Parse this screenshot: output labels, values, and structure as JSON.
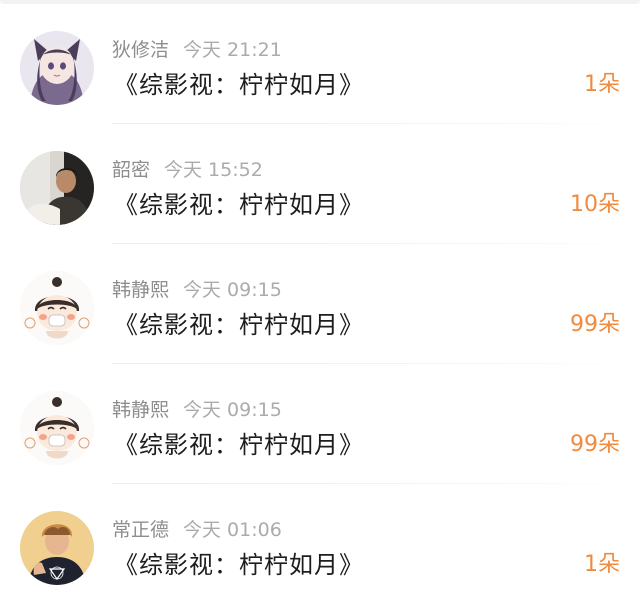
{
  "gifts": [
    {
      "user": "狄修洁",
      "time": "今天 21:21",
      "title": "《综影视：柠柠如月》",
      "count": "1朵",
      "avatar_icon": "anime-cat-girl-avatar"
    },
    {
      "user": "韶密",
      "time": "今天 15:52",
      "title": "《综影视：柠柠如月》",
      "count": "10朵",
      "avatar_icon": "person-photo-avatar"
    },
    {
      "user": "韩静熙",
      "time": "今天 09:15",
      "title": "《综影视：柠柠如月》",
      "count": "99朵",
      "avatar_icon": "cartoon-girl-mask-avatar"
    },
    {
      "user": "韩静熙",
      "time": "今天 09:15",
      "title": "《综影视：柠柠如月》",
      "count": "99朵",
      "avatar_icon": "cartoon-girl-mask-avatar"
    },
    {
      "user": "常正德",
      "time": "今天 01:06",
      "title": "《综影视：柠柠如月》",
      "count": "1朵",
      "avatar_icon": "boy-dark-shirt-avatar"
    }
  ],
  "colors": {
    "count_accent": "#f08a3e",
    "name_gray": "#8e8e8e",
    "time_gray": "#ababab",
    "title_text": "#1d1d1d"
  }
}
